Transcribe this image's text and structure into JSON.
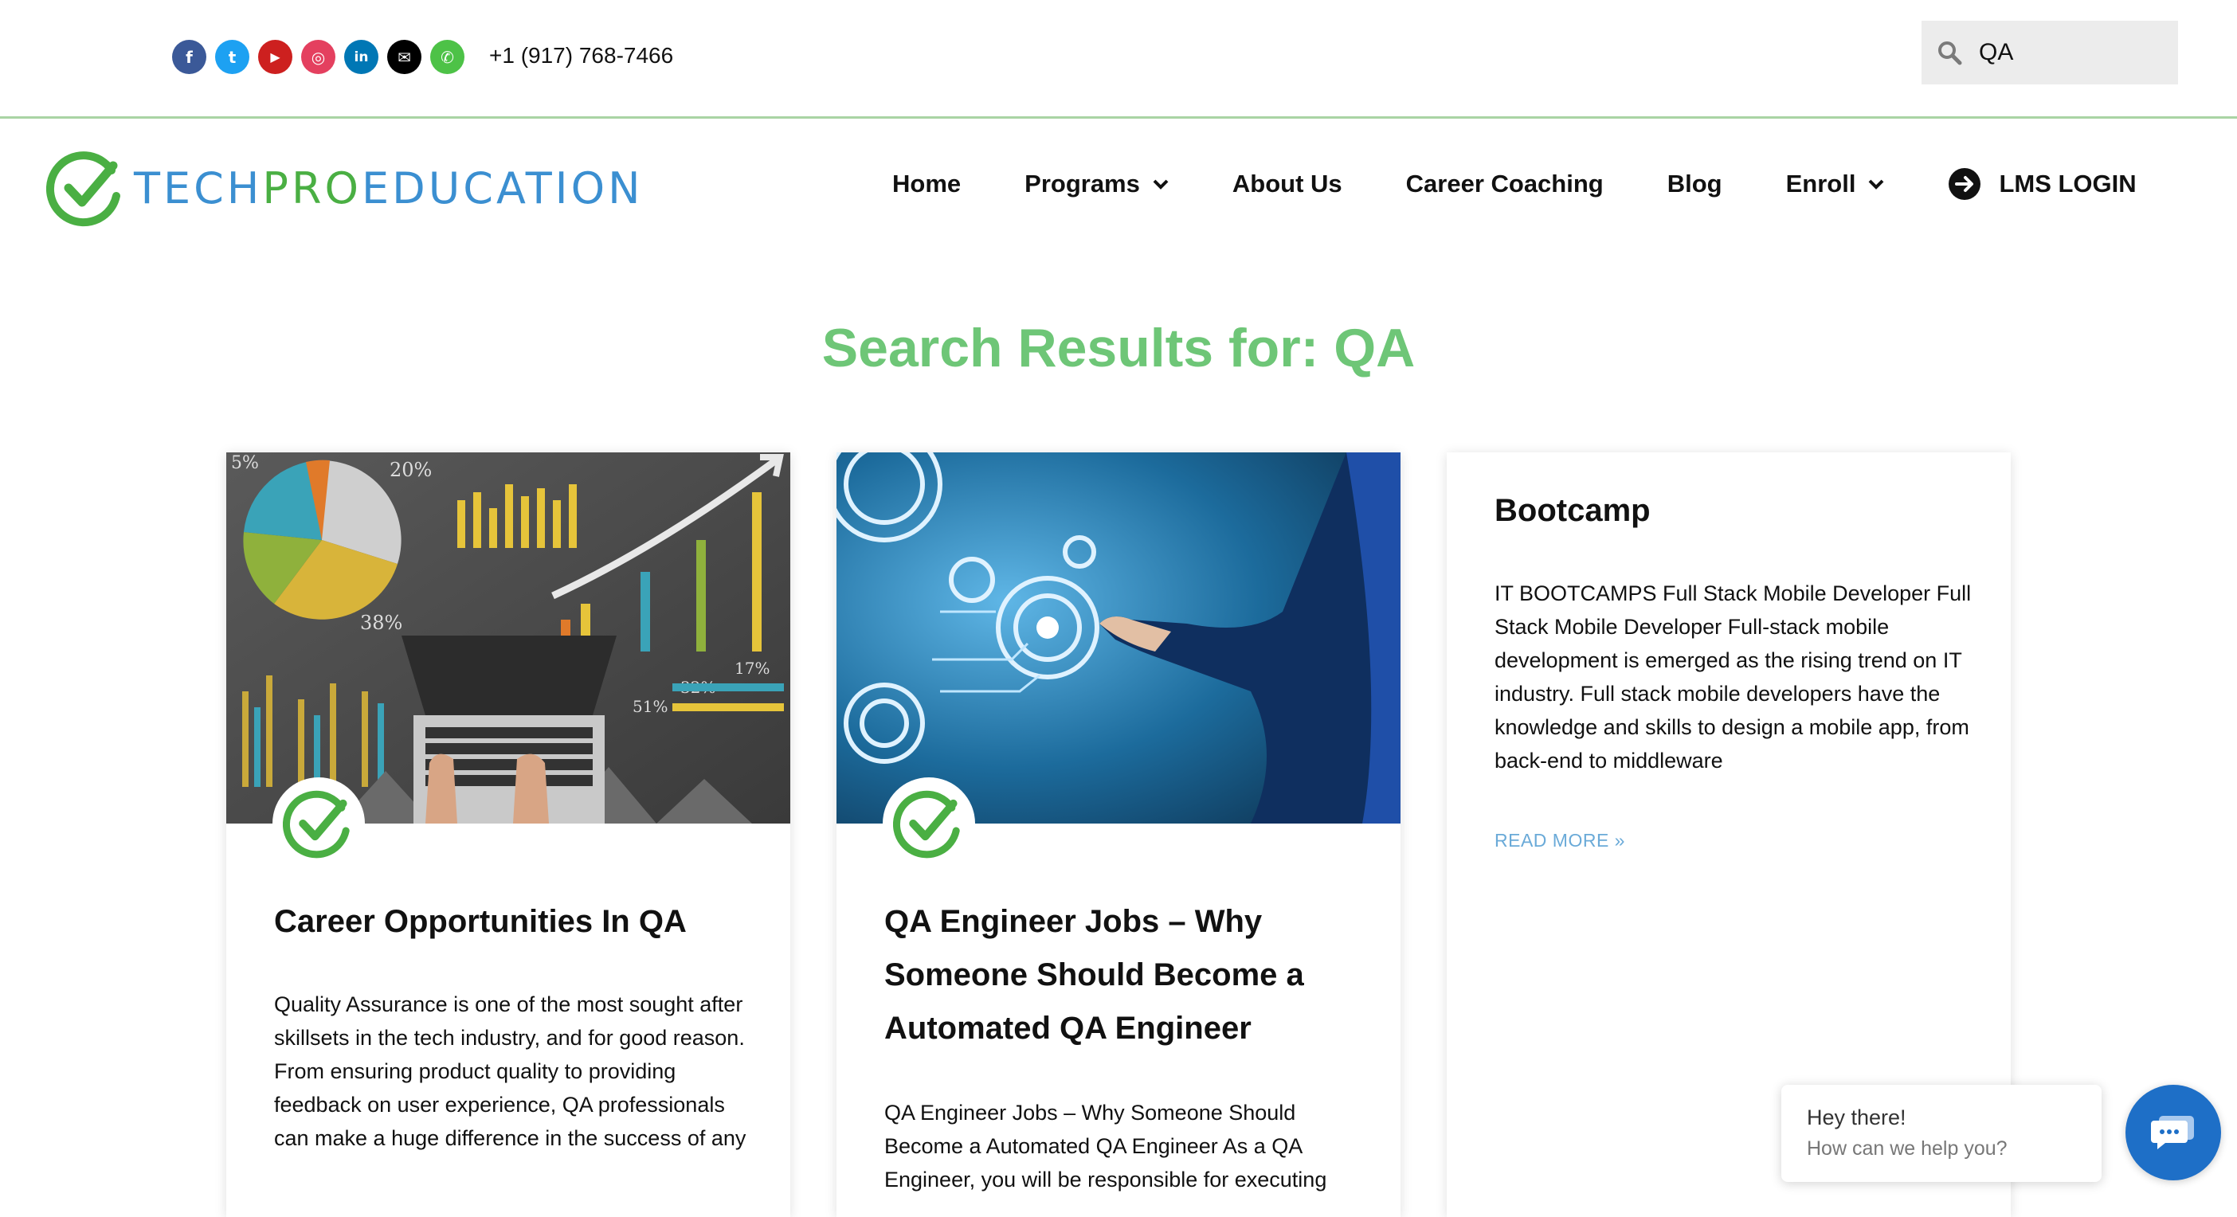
{
  "topbar": {
    "social": [
      {
        "name": "facebook-icon",
        "glyph": "f",
        "color": "#3b5998"
      },
      {
        "name": "twitter-icon",
        "glyph": "t",
        "color": "#1da1f2"
      },
      {
        "name": "youtube-icon",
        "glyph": "▶",
        "color": "#cd201f"
      },
      {
        "name": "instagram-icon",
        "glyph": "◎",
        "color": "#e4405f"
      },
      {
        "name": "linkedin-icon",
        "glyph": "in",
        "color": "#0077b5"
      },
      {
        "name": "email-icon",
        "glyph": "✉",
        "color": "#000000"
      },
      {
        "name": "whatsapp-icon",
        "glyph": "✆",
        "color": "#4dc247"
      }
    ],
    "phone": "+1 (917) 768-7466",
    "search": {
      "value": "QA"
    }
  },
  "brand": {
    "part1": "TECH",
    "part2": "PRO",
    "part3": "EDUCATION"
  },
  "nav": {
    "home": "Home",
    "programs": "Programs",
    "about": "About Us",
    "coaching": "Career Coaching",
    "blog": "Blog",
    "enroll": "Enroll",
    "lms": "LMS LOGIN"
  },
  "page": {
    "heading": "Search Results for: QA"
  },
  "results": [
    {
      "title": "Career Opportunities In QA",
      "excerpt": "Quality Assurance is one of the most sought after skillsets in the tech industry, and for good reason. From ensuring product quality to providing feedback on user experience, QA professionals can make a huge difference in the success of any",
      "chart_labels": [
        "5%",
        "20%",
        "38%",
        "17%",
        "32%",
        "51%"
      ]
    },
    {
      "title": "QA Engineer Jobs – Why Someone Should Become a Automated QA Engineer",
      "excerpt": "QA Engineer Jobs – Why Someone Should Become a Automated QA Engineer As a QA Engineer, you will be responsible for executing"
    },
    {
      "title": "Bootcamp",
      "excerpt": "IT BOOTCAMPS Full Stack Mobile Developer Full Stack Mobile Developer Full-stack mobile development is emerged as the rising trend on IT industry. Full stack mobile developers have the knowledge and skills to design a mobile app, from back-end to middleware",
      "read_more": "READ MORE »"
    }
  ],
  "chat": {
    "greeting": "Hey there!",
    "prompt": "How can we help you?"
  },
  "colors": {
    "accent_green": "#6ec677",
    "brand_blue": "#3b8fd1",
    "brand_green": "#4aaf43",
    "chat_blue": "#1e6fc7"
  }
}
